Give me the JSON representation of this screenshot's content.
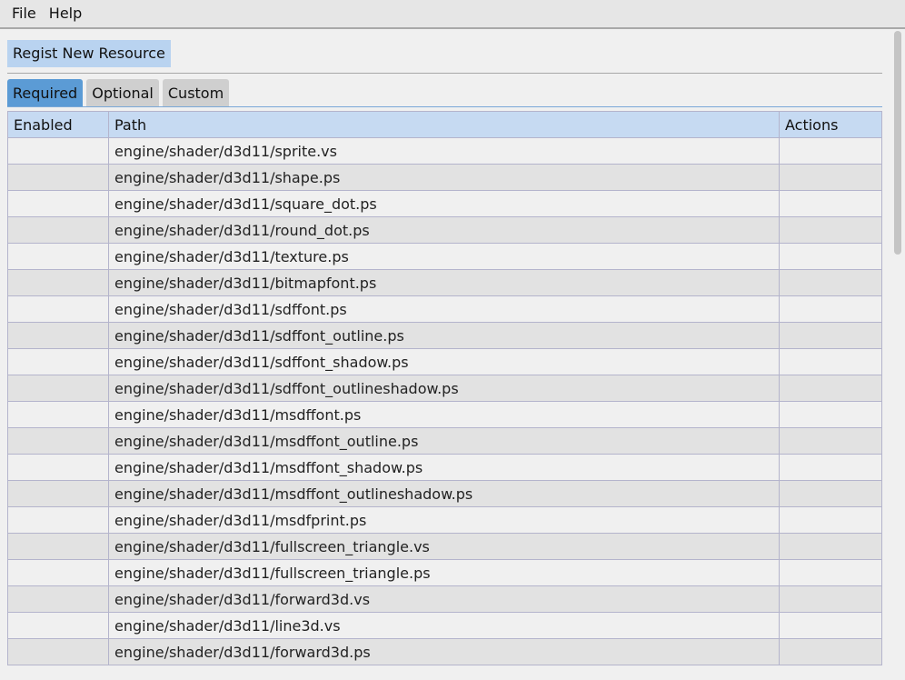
{
  "menu": {
    "file": "File",
    "help": "Help"
  },
  "toolbar": {
    "regist_label": "Regist New Resource"
  },
  "tabs": [
    {
      "label": "Required",
      "active": true
    },
    {
      "label": "Optional",
      "active": false
    },
    {
      "label": "Custom",
      "active": false
    }
  ],
  "table": {
    "headers": {
      "enabled": "Enabled",
      "path": "Path",
      "actions": "Actions"
    },
    "rows": [
      "engine/shader/d3d11/sprite.vs",
      "engine/shader/d3d11/shape.ps",
      "engine/shader/d3d11/square_dot.ps",
      "engine/shader/d3d11/round_dot.ps",
      "engine/shader/d3d11/texture.ps",
      "engine/shader/d3d11/bitmapfont.ps",
      "engine/shader/d3d11/sdffont.ps",
      "engine/shader/d3d11/sdffont_outline.ps",
      "engine/shader/d3d11/sdffont_shadow.ps",
      "engine/shader/d3d11/sdffont_outlineshadow.ps",
      "engine/shader/d3d11/msdffont.ps",
      "engine/shader/d3d11/msdffont_outline.ps",
      "engine/shader/d3d11/msdffont_shadow.ps",
      "engine/shader/d3d11/msdffont_outlineshadow.ps",
      "engine/shader/d3d11/msdfprint.ps",
      "engine/shader/d3d11/fullscreen_triangle.vs",
      "engine/shader/d3d11/fullscreen_triangle.ps",
      "engine/shader/d3d11/forward3d.vs",
      "engine/shader/d3d11/line3d.vs",
      "engine/shader/d3d11/forward3d.ps"
    ]
  },
  "colors": {
    "accent": "#5b9bd5",
    "header_bg": "#c6daf2",
    "button_bg": "#b9d3f0"
  }
}
